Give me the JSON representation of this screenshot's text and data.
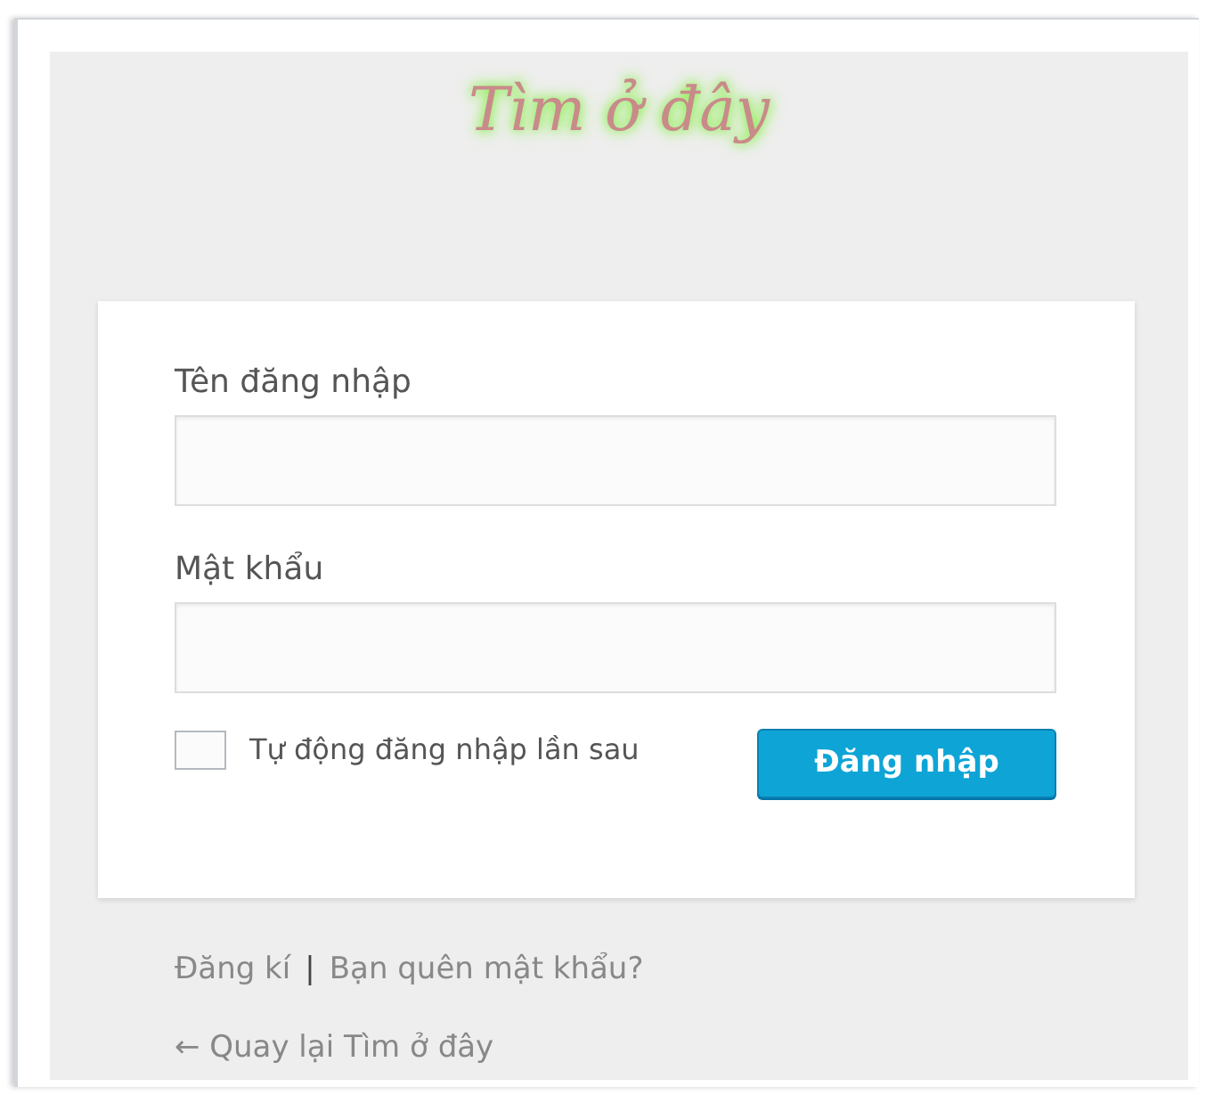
{
  "logo": {
    "title": "Tìm ở đây"
  },
  "form": {
    "username": {
      "label": "Tên đăng nhập"
    },
    "password": {
      "label": "Mật khẩu"
    },
    "remember": {
      "label": "Tự động đăng nhập lần sau",
      "checked": false
    },
    "submit": "Đăng nhập"
  },
  "links": {
    "register": "Đăng kí",
    "separator": "|",
    "forgot": "Bạn quên mật khẩu?",
    "back": "← Quay lại Tìm ở đây"
  }
}
